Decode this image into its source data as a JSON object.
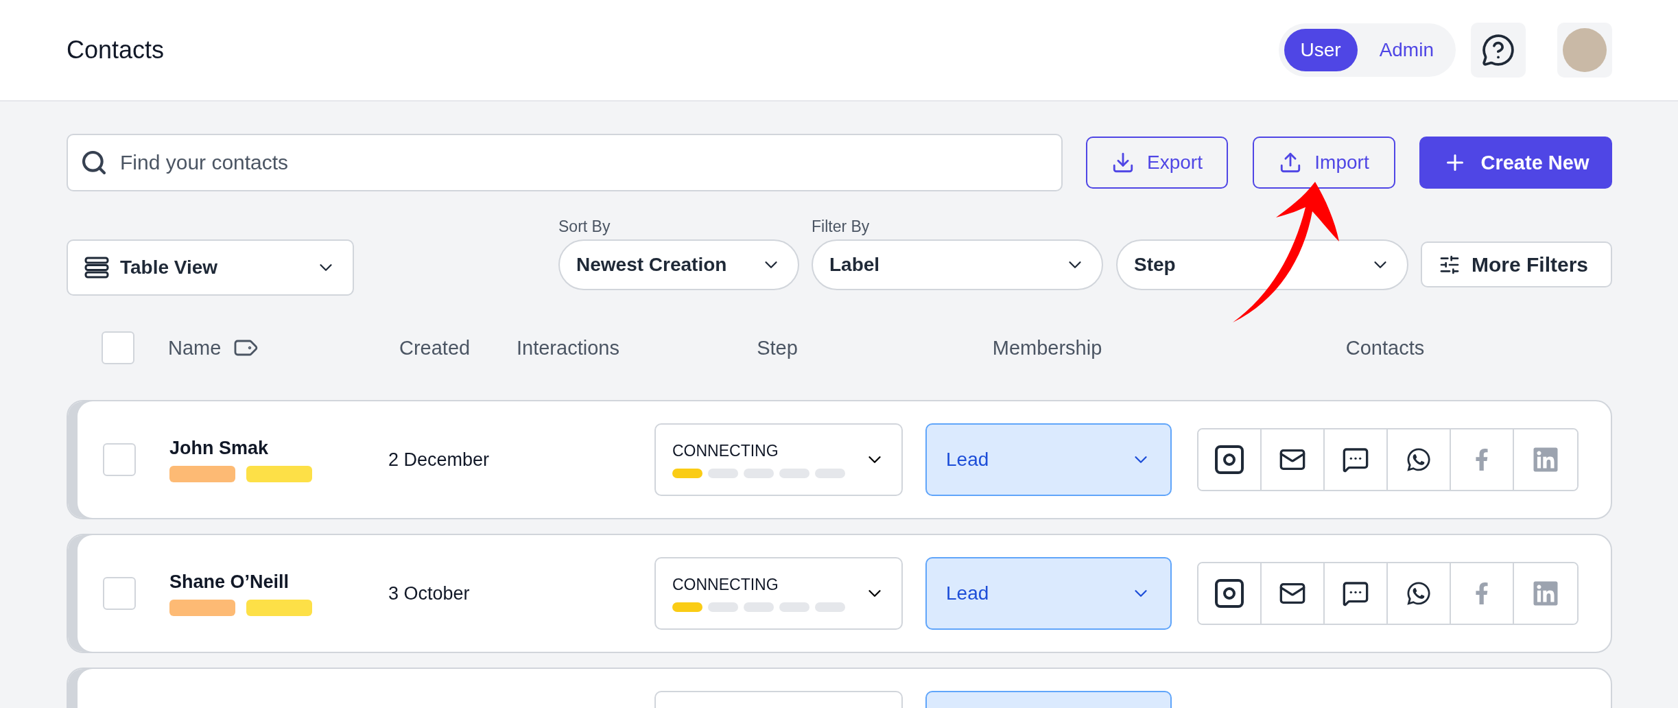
{
  "header": {
    "title": "Contacts",
    "role_toggle": [
      {
        "label": "User",
        "selected": true
      },
      {
        "label": "Admin",
        "selected": false
      }
    ]
  },
  "toolbar": {
    "search": {
      "placeholder": "Find your contacts"
    },
    "export": "Export",
    "import": "Import",
    "create": "Create New"
  },
  "filters": {
    "view": "Table View",
    "sort_label": "Sort By",
    "sort_value": "Newest Creation",
    "filter_label": "Filter By",
    "label_value": "Label",
    "step_value": "Step",
    "more": "More Filters"
  },
  "table": {
    "select_all": {
      "checked": false
    },
    "columns": [
      "Name",
      "Created",
      "Interactions",
      "Step",
      "Membership",
      "Contacts"
    ],
    "rows": [
      {
        "checked": false,
        "name": "John Smak",
        "labels": [
          {
            "color": "#fdba74"
          },
          {
            "color": "#fde047"
          }
        ],
        "created": "2 December",
        "step": "CONNECTING",
        "level": 0.2,
        "membership": "Lead",
        "channels": [
          {
            "kind": "instagram",
            "active": true
          },
          {
            "kind": "mail",
            "active": true
          },
          {
            "kind": "chat",
            "active": true
          },
          {
            "kind": "whatsapp",
            "active": true
          },
          {
            "kind": "facebook",
            "active": false
          },
          {
            "kind": "linkedin",
            "active": false
          }
        ]
      },
      {
        "checked": false,
        "name": "Shane O’Neill",
        "labels": [
          {
            "color": "#fdba74"
          },
          {
            "color": "#fde047"
          }
        ],
        "created": "3 October",
        "step": "CONNECTING",
        "level": 0.2,
        "membership": "Lead",
        "channels": [
          {
            "kind": "instagram",
            "active": true
          },
          {
            "kind": "mail",
            "active": true
          },
          {
            "kind": "chat",
            "active": true
          },
          {
            "kind": "whatsapp",
            "active": true
          },
          {
            "kind": "facebook",
            "active": false
          },
          {
            "kind": "linkedin",
            "active": false
          }
        ]
      }
    ],
    "more_rows_below": true
  },
  "annotation": {
    "arrow": true
  }
}
